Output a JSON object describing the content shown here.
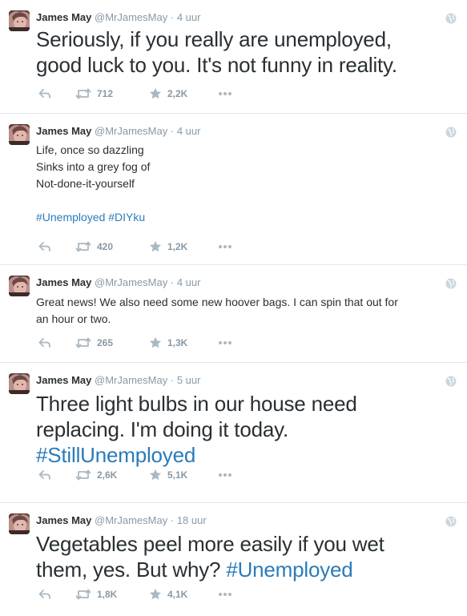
{
  "tweets": [
    {
      "name": "James May",
      "handle": "@MrJamesMay",
      "separator": "·",
      "time": "4 uur",
      "lines": [
        "Seriously, if you really are unemployed,",
        "good luck to you. It's not funny in reality."
      ],
      "hashtag": "",
      "retweets": "712",
      "favorites": "2,2K"
    },
    {
      "name": "James May",
      "handle": "@MrJamesMay",
      "separator": "·",
      "time": "4 uur",
      "lines": [
        "Life, once so dazzling",
        "Sinks into a grey fog of",
        "Not-done-it-yourself"
      ],
      "hashtag": "#Unemployed #DIYku",
      "retweets": "420",
      "favorites": "1,2K"
    },
    {
      "name": "James May",
      "handle": "@MrJamesMay",
      "separator": "·",
      "time": "4 uur",
      "lines": [
        "Great news! We also need some new hoover bags. I can spin that out for",
        "an hour or two."
      ],
      "hashtag": "",
      "retweets": "265",
      "favorites": "1,3K"
    },
    {
      "name": "James May",
      "handle": "@MrJamesMay",
      "separator": "·",
      "time": "5 uur",
      "lines": [
        "Three light bulbs in our house need",
        "replacing. I'm doing it today."
      ],
      "hashtag": "#StillUnemployed",
      "retweets": "2,6K",
      "favorites": "5,1K"
    },
    {
      "name": "James May",
      "handle": "@MrJamesMay",
      "separator": "·",
      "time": "18 uur",
      "lines": [
        "Vegetables peel more easily if you wet",
        "them, yes. But why? "
      ],
      "hashtag": "#Unemployed",
      "retweets": "1,8K",
      "favorites": "4,1K"
    }
  ],
  "colors": {
    "hashtag": "#2b7bb9",
    "muted": "#8899a6",
    "text": "#292f33",
    "divider": "#e1e8ed"
  },
  "icons": [
    "reply-icon",
    "retweet-icon",
    "favorite-icon",
    "more-icon",
    "globe-icon",
    "avatar"
  ]
}
